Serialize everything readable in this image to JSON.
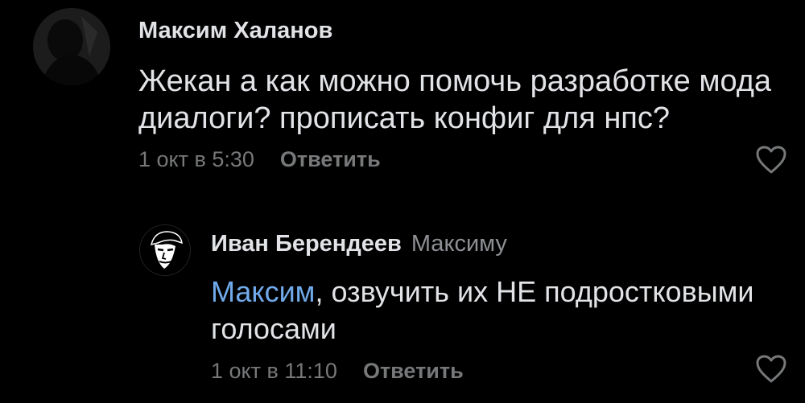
{
  "comments": [
    {
      "author": "Максим Халанов",
      "text": "Жекан а как можно помочь разработке мода диалоги? прописать конфиг для нпс?",
      "time": "1 окт в 5:30",
      "reply_label": "Ответить",
      "avatar_icon": "dark-figure-avatar",
      "like_icon": "heart-outline-icon"
    },
    {
      "author": "Иван Берендеев",
      "reply_to": "Максиму",
      "mention": "Максим",
      "text": ", озвучить их НЕ подростковыми голосами",
      "time": "1 окт в 11:10",
      "reply_label": "Ответить",
      "avatar_icon": "che-guevara-avatar",
      "like_icon": "heart-outline-icon"
    }
  ],
  "colors": {
    "background": "#000000",
    "text": "#e1e3e6",
    "secondary": "#76787a",
    "mention": "#71aaeb"
  }
}
